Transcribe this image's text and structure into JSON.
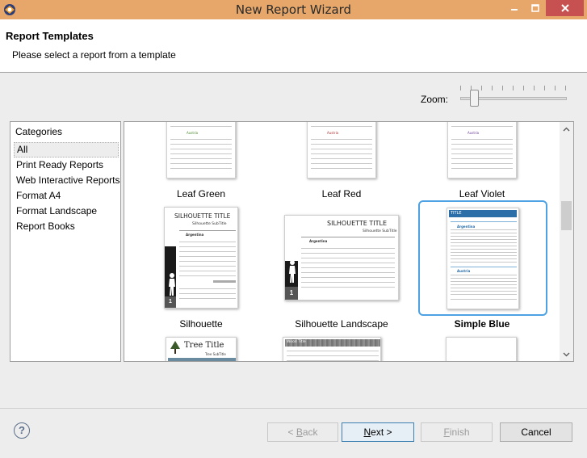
{
  "window": {
    "title": "New Report Wizard"
  },
  "header": {
    "title": "Report Templates",
    "subtitle": "Please select a report from a template"
  },
  "zoom": {
    "label": "Zoom:",
    "level": 0.1
  },
  "categories": {
    "title": "Categories",
    "items": [
      "All",
      "Print Ready Reports",
      "Web Interactive Reports",
      "Format A4",
      "Format Landscape",
      "Report Books"
    ],
    "selected": "All"
  },
  "templates": {
    "items": [
      {
        "label": "Leaf Green"
      },
      {
        "label": "Leaf Red"
      },
      {
        "label": "Leaf Violet"
      },
      {
        "label": "Silhouette",
        "thumb_title": "SILHOUETTE TITLE",
        "thumb_subtitle": "Silhouette SubTitle",
        "thumb_group": "Argentina",
        "thumb_page": "1"
      },
      {
        "label": "Silhouette Landscape",
        "thumb_title": "SILHOUETTE TITLE",
        "thumb_subtitle": "Silhouette SubTitle",
        "thumb_group": "Argentina",
        "thumb_page": "1"
      },
      {
        "label": "Simple Blue",
        "thumb_title": "TITLE",
        "thumb_group": "Argentina",
        "thumb_group2": "Austria"
      },
      {
        "thumb_title": "Tree Title",
        "thumb_subtitle": "Tree SubTitle"
      },
      {
        "thumb_title": "Wood Title"
      },
      {}
    ],
    "selected": "Simple Blue",
    "accent": "#4ea2e3"
  },
  "footer": {
    "help_symbol": "?",
    "back": {
      "arrow": "< ",
      "mnemonic": "B",
      "rest": "ack"
    },
    "next": {
      "mnemonic": "N",
      "rest": "ext >"
    },
    "finish": {
      "mnemonic": "F",
      "rest": "inish"
    },
    "cancel": "Cancel"
  },
  "colors": {
    "titlebar": "#e7a76a",
    "close": "#c75050"
  }
}
